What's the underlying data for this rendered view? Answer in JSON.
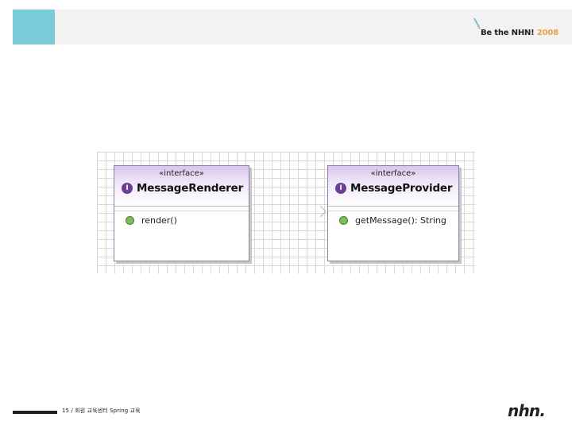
{
  "header": {
    "brand_main": "Be the NHN!",
    "brand_year": "2008"
  },
  "diagram": {
    "classes": [
      {
        "stereotype": "«interface»",
        "name": "MessageRenderer",
        "method": "render()"
      },
      {
        "stereotype": "«interface»",
        "name": "MessageProvider",
        "method": "getMessage(): String"
      }
    ]
  },
  "footer": {
    "page_label": "15 / 회원 교육센터 Spring 교육",
    "logo_text": "nhn."
  },
  "colors": {
    "header_accent": "#7ccbdb",
    "header_bar": "#f2f2f2",
    "uml_head_purple": "#d8c6ea",
    "interface_icon": "#6b3f96",
    "method_icon": "#7dbf57",
    "brand_year": "#e6a24b"
  }
}
